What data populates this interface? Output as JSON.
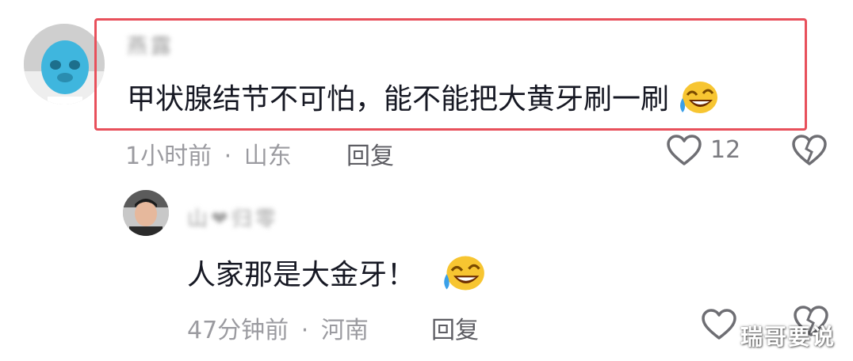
{
  "comment": {
    "username": "燕露",
    "text": "甲状腺结节不可怕，能不能把大黄牙刷一刷",
    "emoji": "laughing-tears-emoji",
    "time": "1小时前",
    "separator": "·",
    "location": "山东",
    "reply_label": "回复",
    "like_count": "12",
    "highlight_color": "#e8505b"
  },
  "reply": {
    "username": "山❤归零",
    "text": "人家那是大金牙！",
    "emoji": "laughing-tears-emoji",
    "time": "47分钟前",
    "separator": "·",
    "location": "河南",
    "reply_label": "回复"
  },
  "watermark": "瑞哥要说"
}
